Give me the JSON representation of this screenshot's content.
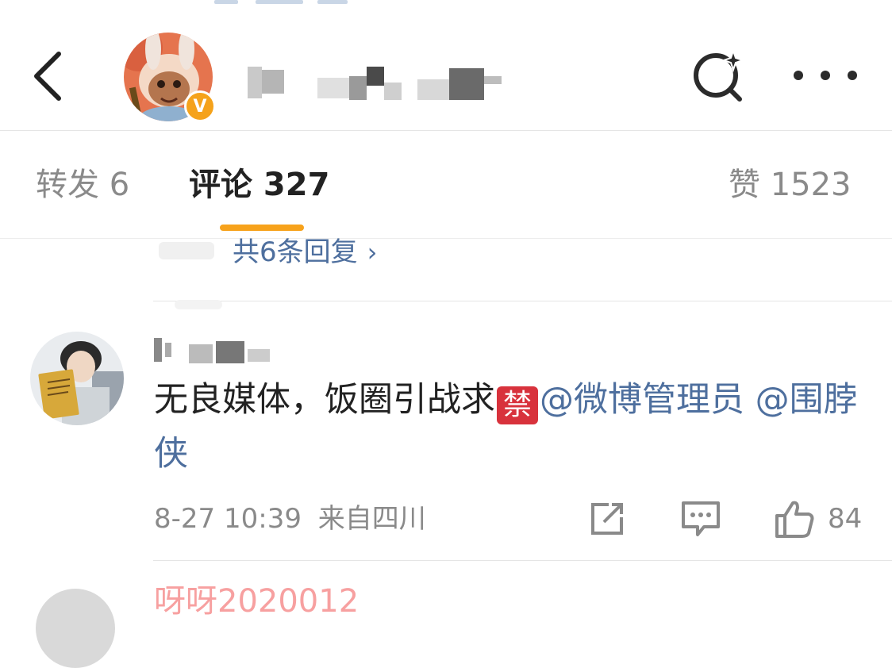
{
  "header": {
    "back_icon": "chevron-left-icon",
    "verified_badge": "V",
    "search_icon": "search-sparkle-icon",
    "more_icon": "more-horizontal-icon",
    "accent_color": "#f7a21b"
  },
  "tabs": [
    {
      "label": "转发 6"
    },
    {
      "label": "评论 327"
    },
    {
      "label": "赞 1523"
    }
  ],
  "reply_link": "共6条回复",
  "comment": {
    "text_before": "无良媒体，饭圈引战求",
    "ban_emoji": "禁",
    "mention_1": "@微博管理员",
    "mention_2": "@围脖侠",
    "date": "8-27 10:39",
    "location": "来自四川",
    "likes": "84",
    "mention_color": "#4e6f9e"
  },
  "next_comment": {
    "name": "呀呀2020012"
  }
}
